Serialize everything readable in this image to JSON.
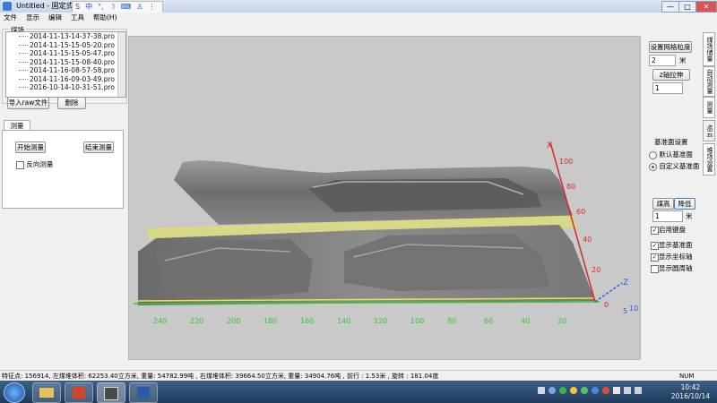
{
  "window": {
    "title": "Untitled - 固定式激光...",
    "btn_min": "—",
    "btn_max": "□",
    "btn_close": "✕"
  },
  "ime": {
    "logo": "S",
    "lang": "中",
    "punct": "°,",
    "moon": "☽",
    "kbd": "⌨",
    "user": "♙",
    "more": "⋮"
  },
  "menu": [
    "文件",
    "显示",
    "编辑",
    "工具",
    "帮助(H)"
  ],
  "left_panel": {
    "group_label": "煤场",
    "files": [
      "2014-11-13-14-37-38.pro",
      "2014-11-15-15-05-20.pro",
      "2014-11-15-15-05-47.pro",
      "2014-11-15-15-08-40.pro",
      "2014-11-16-08-57-58.pro",
      "2014-11-16-09-03-49.pro",
      "2016-10-14-10-31-51.pro"
    ],
    "import_button": "导入raw文件",
    "delete_button": "删除",
    "tab_label": "测量",
    "start_button": "开始测量",
    "end_button": "结束测量",
    "reverse_label": "反向测量"
  },
  "right_panel": {
    "grid_button": "设置网格粒度",
    "grid_value": "2",
    "grid_unit": "米",
    "z_button": "z轴拉伸",
    "z_value": "1",
    "tabs": [
      "煤场储量",
      "自动测量",
      "测量",
      "点云",
      "堆场设置"
    ],
    "base_group": "基准面设置",
    "radio_default": "默认基准面",
    "radio_custom": "自定义基准面",
    "raise_button": "煤高",
    "lower_button": "降低",
    "step_value": "1",
    "step_unit": "米",
    "check_keyboard": "启用键盘",
    "check_base": "显示基准面",
    "check_axis": "显示坐标轴",
    "check_circle": "显示圆周轴"
  },
  "viewport": {
    "x_ticks": [
      "240",
      "220",
      "200",
      "180",
      "160",
      "140",
      "120",
      "100",
      "80",
      "60",
      "40",
      "20"
    ],
    "y_ticks": [
      "100",
      "80",
      "60",
      "40",
      "20",
      "0"
    ],
    "axis_x_label": "X",
    "axis_z_label": "Z",
    "axis_y_origin": "5",
    "axis_y_origin2": "10"
  },
  "status": {
    "text": "特征点: 156914, 左煤堆体积: 62253.40立方米, 重量: 54782.99吨 , 右煤堆体积: 39664.50立方米, 重量: 34904.76吨 , 前行 : 1.53米 , 旋转 : 181.04度",
    "num": "NUM"
  },
  "taskbar": {
    "time": "10:42",
    "date": "2016/10/14"
  },
  "colors": {
    "axis_red": "#d8282a",
    "axis_green": "#32c832",
    "axis_blue": "#2a5bd8",
    "yellow_grid": "#e6e64a"
  }
}
